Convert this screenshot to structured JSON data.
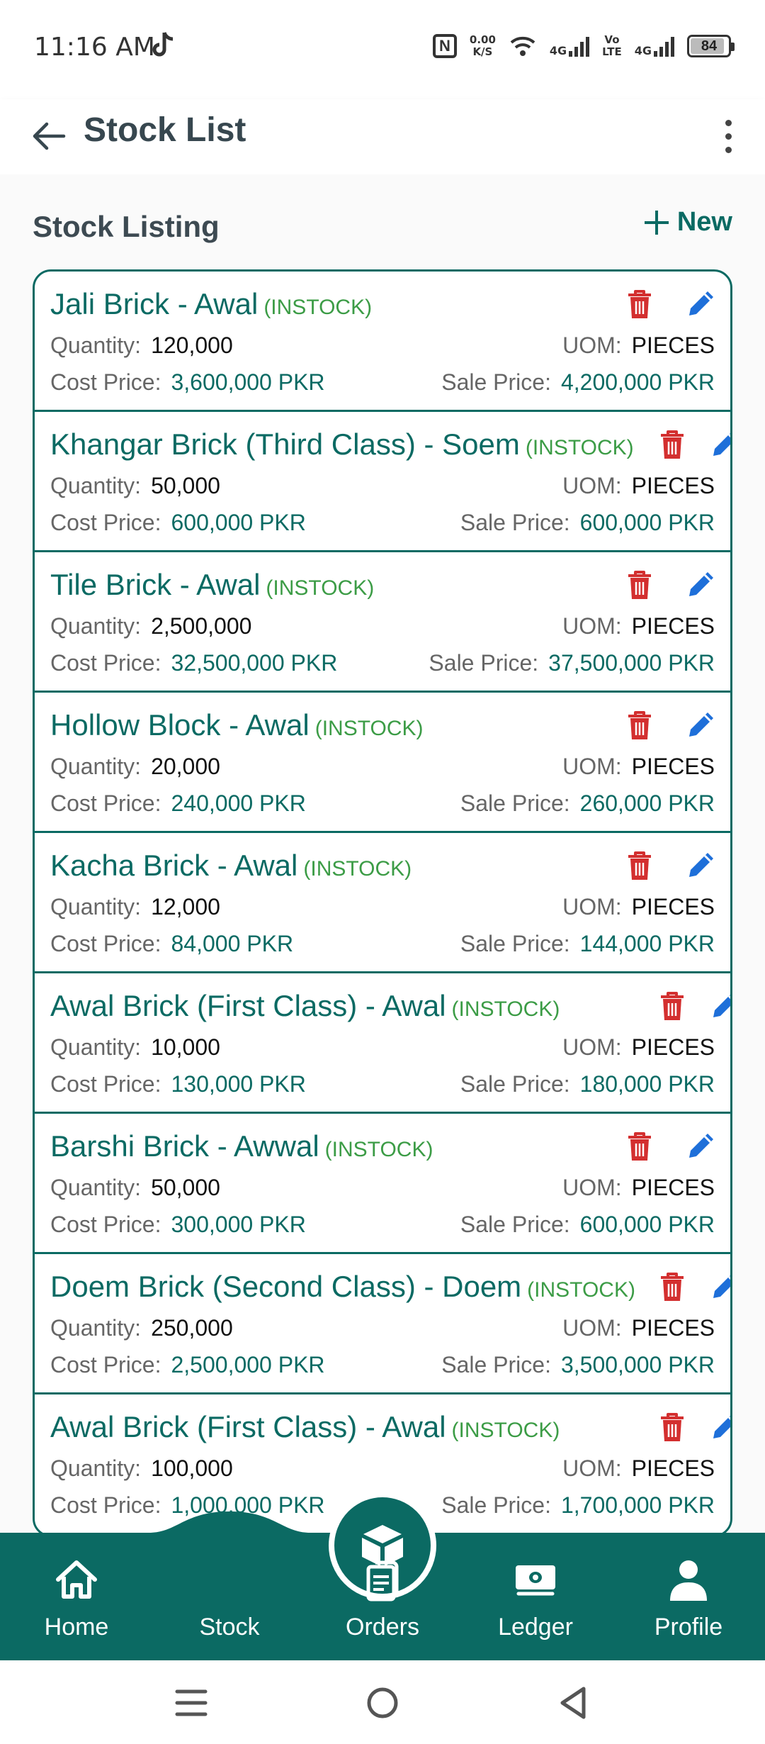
{
  "status_bar": {
    "time": "11:16 AM",
    "speed_top": "0.00",
    "speed_bottom": "K/S",
    "net1": "4G",
    "volte_top": "Vo",
    "volte_bottom": "LTE",
    "net2": "4G",
    "battery": "84"
  },
  "app_bar": {
    "title": "Stock List"
  },
  "section": {
    "title": "Stock Listing",
    "new_label": "New"
  },
  "labels": {
    "quantity": "Quantity:",
    "uom": "UOM:",
    "cost_price": "Cost Price:",
    "sale_price": "Sale Price:"
  },
  "items": [
    {
      "name": "Jali Brick - Awal",
      "status": "(INSTOCK)",
      "quantity": "120,000",
      "uom": "PIECES",
      "cost": "3,600,000 PKR",
      "sale": "4,200,000 PKR"
    },
    {
      "name": "Khangar Brick (Third Class) - Soem",
      "status": "(INSTOCK)",
      "quantity": "50,000",
      "uom": "PIECES",
      "cost": "600,000 PKR",
      "sale": "600,000 PKR"
    },
    {
      "name": "Tile Brick - Awal",
      "status": "(INSTOCK)",
      "quantity": "2,500,000",
      "uom": "PIECES",
      "cost": "32,500,000 PKR",
      "sale": "37,500,000 PKR"
    },
    {
      "name": "Hollow Block - Awal",
      "status": "(INSTOCK)",
      "quantity": "20,000",
      "uom": "PIECES",
      "cost": "240,000 PKR",
      "sale": "260,000 PKR"
    },
    {
      "name": "Kacha Brick - Awal",
      "status": "(INSTOCK)",
      "quantity": "12,000",
      "uom": "PIECES",
      "cost": "84,000 PKR",
      "sale": "144,000 PKR"
    },
    {
      "name": "Awal Brick (First Class) - Awal",
      "status": "(INSTOCK)",
      "quantity": "10,000",
      "uom": "PIECES",
      "cost": "130,000 PKR",
      "sale": "180,000 PKR"
    },
    {
      "name": "Barshi Brick - Awwal",
      "status": "(INSTOCK)",
      "quantity": "50,000",
      "uom": "PIECES",
      "cost": "300,000 PKR",
      "sale": "600,000 PKR"
    },
    {
      "name": "Doem Brick (Second Class) - Doem",
      "status": "(INSTOCK)",
      "quantity": "250,000",
      "uom": "PIECES",
      "cost": "2,500,000 PKR",
      "sale": "3,500,000 PKR"
    },
    {
      "name": "Awal Brick (First Class) - Awal",
      "status": "(INSTOCK)",
      "quantity": "100,000",
      "uom": "PIECES",
      "cost": "1,000,000 PKR",
      "sale": "1,700,000 PKR"
    }
  ],
  "bottom_nav": [
    {
      "label": "Home",
      "icon": "home-icon"
    },
    {
      "label": "Stock",
      "icon": "box-icon"
    },
    {
      "label": "Orders",
      "icon": "clipboard-icon"
    },
    {
      "label": "Ledger",
      "icon": "cash-icon"
    },
    {
      "label": "Profile",
      "icon": "person-icon"
    }
  ],
  "colors": {
    "primary": "#0b6a63",
    "instock": "#3c9c46",
    "delete": "#d32f2f",
    "edit": "#1e6fd9"
  }
}
